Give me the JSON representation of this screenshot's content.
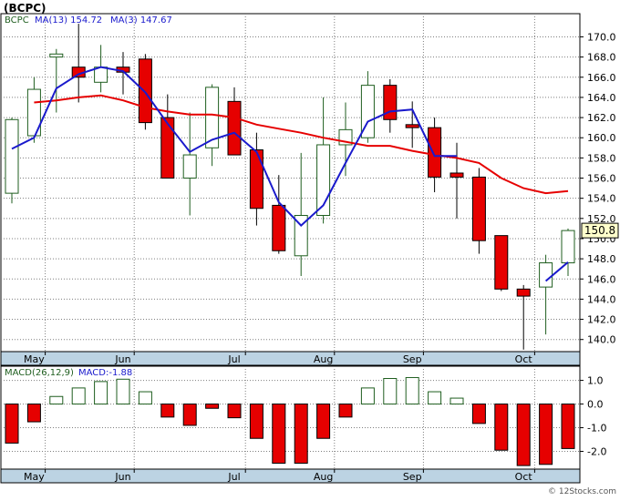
{
  "header": {
    "title": "(BCPC)",
    "copyright": "© 12Stocks.com"
  },
  "colors": {
    "up_fill": "#ffffff",
    "down_fill": "#e60000",
    "candle_outline": "#1f5e1f",
    "ma13": "#e60000",
    "ma3": "#1a1acc",
    "macd_up_outline": "#1f5e1f",
    "macd_down_fill": "#e60000",
    "grid": "#7f7f7f",
    "axis_band": "#bcd3e3",
    "last_label_bg": "#ffffcc"
  },
  "chart_data": [
    {
      "type": "candlestick",
      "legend": [
        {
          "name": "BCPC",
          "value": "",
          "color": "#1f5e1f"
        },
        {
          "name": "MA(13)",
          "value": "154.72",
          "color": "#1a1acc"
        },
        {
          "name": "MA(3)",
          "value": "147.67",
          "color": "#1a1acc"
        }
      ],
      "x_tick_labels": [
        "May",
        "Jun",
        "Jul",
        "Aug",
        "Sep",
        "Oct"
      ],
      "x_tick_index": [
        1,
        5,
        10,
        14,
        18,
        23
      ],
      "y_ticks": [
        140,
        142,
        144,
        146,
        148,
        150,
        152,
        154,
        156,
        158,
        160,
        162,
        164,
        166,
        168,
        170
      ],
      "y_tick_labels": [
        "140.0",
        "142.0",
        "144.0",
        "146.0",
        "148.0",
        "150.0",
        "152.0",
        "154.0",
        "156.0",
        "158.0",
        "160.0",
        "162.0",
        "164.0",
        "166.0",
        "168.0",
        "170.0"
      ],
      "ylim": [
        138.8,
        172.3
      ],
      "grid": true,
      "last_price_label": "150.8",
      "last_price": 150.8,
      "candles": [
        {
          "o": 154.5,
          "h": 162.0,
          "l": 153.5,
          "c": 161.8
        },
        {
          "o": 160.2,
          "h": 166.0,
          "l": 159.5,
          "c": 164.8
        },
        {
          "o": 168.0,
          "h": 168.8,
          "l": 162.5,
          "c": 168.3
        },
        {
          "o": 167.0,
          "h": 171.3,
          "l": 163.5,
          "c": 166.0
        },
        {
          "o": 165.5,
          "h": 169.2,
          "l": 164.5,
          "c": 167.0
        },
        {
          "o": 167.0,
          "h": 168.5,
          "l": 164.3,
          "c": 166.5
        },
        {
          "o": 167.8,
          "h": 168.3,
          "l": 160.8,
          "c": 161.5
        },
        {
          "o": 162.0,
          "h": 164.3,
          "l": 156.0,
          "c": 156.0
        },
        {
          "o": 156.0,
          "h": 162.5,
          "l": 152.3,
          "c": 158.3
        },
        {
          "o": 159.0,
          "h": 165.3,
          "l": 157.2,
          "c": 165.0
        },
        {
          "o": 163.6,
          "h": 165.0,
          "l": 158.3,
          "c": 158.3
        },
        {
          "o": 158.8,
          "h": 160.5,
          "l": 151.3,
          "c": 153.0
        },
        {
          "o": 153.3,
          "h": 156.3,
          "l": 148.5,
          "c": 148.8
        },
        {
          "o": 148.3,
          "h": 158.5,
          "l": 146.3,
          "c": 152.3
        },
        {
          "o": 152.3,
          "h": 164.0,
          "l": 151.5,
          "c": 159.3
        },
        {
          "o": 159.3,
          "h": 163.5,
          "l": 156.2,
          "c": 160.8
        },
        {
          "o": 160.0,
          "h": 166.6,
          "l": 159.5,
          "c": 165.2
        },
        {
          "o": 165.2,
          "h": 165.8,
          "l": 160.5,
          "c": 161.8
        },
        {
          "o": 161.3,
          "h": 163.6,
          "l": 159.0,
          "c": 161.0
        },
        {
          "o": 161.0,
          "h": 162.0,
          "l": 154.6,
          "c": 156.1
        },
        {
          "o": 156.5,
          "h": 159.5,
          "l": 152.0,
          "c": 156.1
        },
        {
          "o": 156.1,
          "h": 157.0,
          "l": 148.5,
          "c": 149.8
        },
        {
          "o": 150.3,
          "h": 150.3,
          "l": 144.8,
          "c": 145.0
        },
        {
          "o": 145.0,
          "h": 145.4,
          "l": 139.0,
          "c": 144.3
        },
        {
          "o": 145.2,
          "h": 148.4,
          "l": 140.5,
          "c": 147.6
        },
        {
          "o": 147.6,
          "h": 151.0,
          "l": 146.3,
          "c": 150.8
        }
      ],
      "ma13": [
        null,
        163.5,
        163.7,
        164.0,
        164.2,
        163.7,
        163.0,
        162.6,
        162.3,
        162.3,
        162.0,
        161.3,
        160.9,
        160.5,
        160.0,
        159.6,
        159.2,
        159.2,
        158.7,
        158.3,
        158.0,
        157.5,
        156.0,
        155.0,
        154.5,
        154.72
      ],
      "ma3": [
        158.9,
        160.0,
        164.9,
        166.3,
        167.0,
        166.6,
        164.5,
        161.4,
        158.6,
        159.8,
        160.5,
        158.6,
        153.6,
        151.3,
        153.3,
        157.5,
        161.6,
        162.6,
        162.8,
        158.2,
        158.2,
        null,
        null,
        null,
        145.8,
        147.67
      ]
    },
    {
      "type": "bar",
      "legend": [
        {
          "name": "MACD(26,12,9)",
          "value": "",
          "color": "#1f5e1f"
        },
        {
          "name": "MACD:",
          "value": "-1.88",
          "color": "#1a1acc"
        }
      ],
      "x_tick_labels": [
        "May",
        "Jun",
        "Jul",
        "Aug",
        "Sep",
        "Oct"
      ],
      "y_ticks": [
        1.0,
        0.0,
        -1.0,
        -2.0
      ],
      "y_tick_labels": [
        "1.0",
        "0.0",
        "-1.0",
        "-2.0"
      ],
      "ylim": [
        -2.75,
        1.6
      ],
      "grid": true,
      "values": [
        -1.65,
        -0.75,
        0.32,
        0.68,
        0.95,
        1.05,
        0.52,
        -0.55,
        -0.9,
        -0.18,
        -0.58,
        -1.45,
        -2.5,
        -2.5,
        -1.45,
        -0.55,
        0.68,
        1.08,
        1.12,
        0.52,
        0.25,
        -0.82,
        -1.95,
        -2.6,
        -2.55,
        -1.88
      ]
    }
  ]
}
